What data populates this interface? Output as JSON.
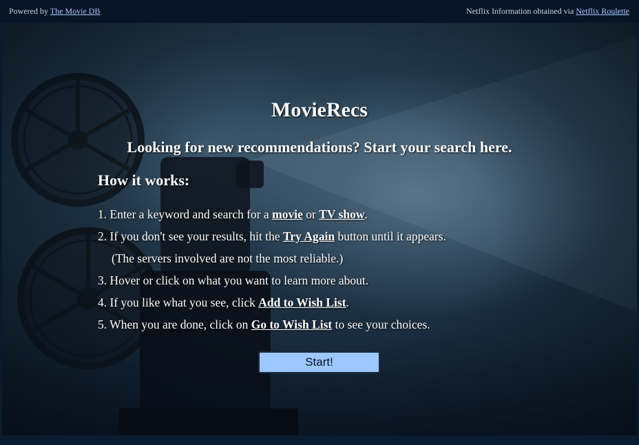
{
  "topbar": {
    "powered_prefix": "Powered by",
    "powered_link": "The Movie DB",
    "netflix_prefix": "Netflix Information obtained via",
    "netflix_link": "Netflix Roulette"
  },
  "main": {
    "title": "MovieRecs",
    "subtitle": "Looking for new recommendations? Start your search here.",
    "how_heading": "How it works:",
    "steps": [
      {
        "pre": "1. Enter a keyword and search for a ",
        "link1": "movie",
        "mid": " or ",
        "link2": "TV show",
        "post": "."
      },
      {
        "pre": "2. If you don't see your results, hit the ",
        "link1": "Try Again",
        "post": " button until it appears."
      },
      {
        "text": "(The servers involved are not the most reliable.)"
      },
      {
        "text": "3. Hover or click on what you want to learn more about."
      },
      {
        "pre": "4. If you like what you see, click ",
        "link1": "Add to Wish List",
        "post": "."
      },
      {
        "pre": "5. When you are done, click on ",
        "link1": "Go to Wish List",
        "post": " to see your choices."
      }
    ],
    "start_button": "Start!"
  },
  "colors": {
    "topbar_bg": "#071425",
    "link": "#a9c8ff",
    "button_bg": "#9cc8ff"
  },
  "background_image": "film-projector-photo"
}
